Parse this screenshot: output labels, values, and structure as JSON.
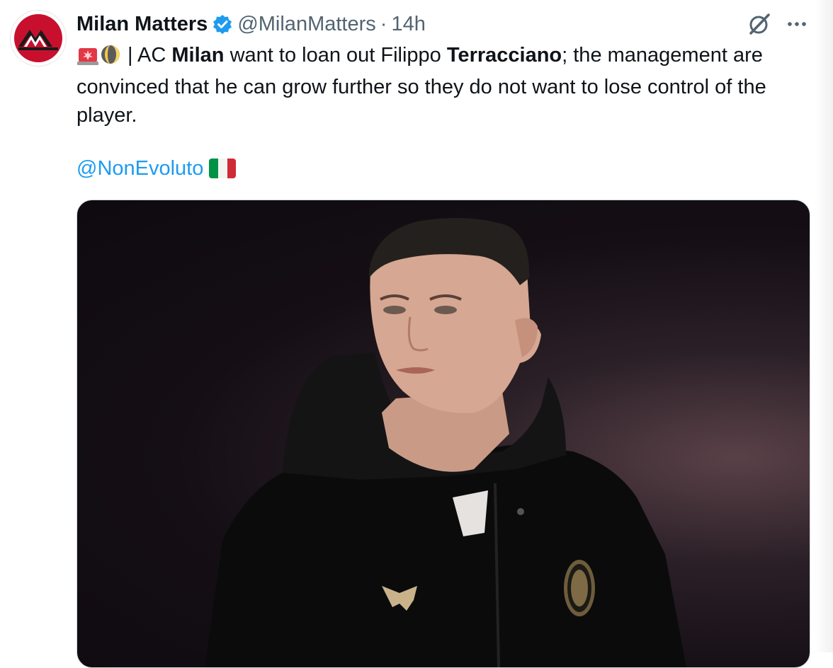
{
  "tweet": {
    "display_name": "Milan Matters",
    "handle": "@MilanMatters",
    "separator": "·",
    "time": "14h",
    "text_sep": " | AC ",
    "text_b1": "Milan",
    "text_mid": " want to loan out Filippo ",
    "text_b2": "Terracciano",
    "text_end": "; the management are convinced that he can grow further so they do not want to lose control of the player.",
    "mention": "@NonEvoluto"
  },
  "icons": {
    "avatar": "milan-matters-logo",
    "verified": "verified-badge-icon",
    "grok": "grok-icon",
    "more": "more-icon",
    "emoji1": "siren-emoji",
    "emoji2": "moon-emoji",
    "flag": "italy-flag-emoji"
  },
  "colors": {
    "link": "#1d9bf0",
    "verified": "#1d9bf0",
    "secondary_text": "#536471",
    "avatar_red": "#c8102e"
  }
}
